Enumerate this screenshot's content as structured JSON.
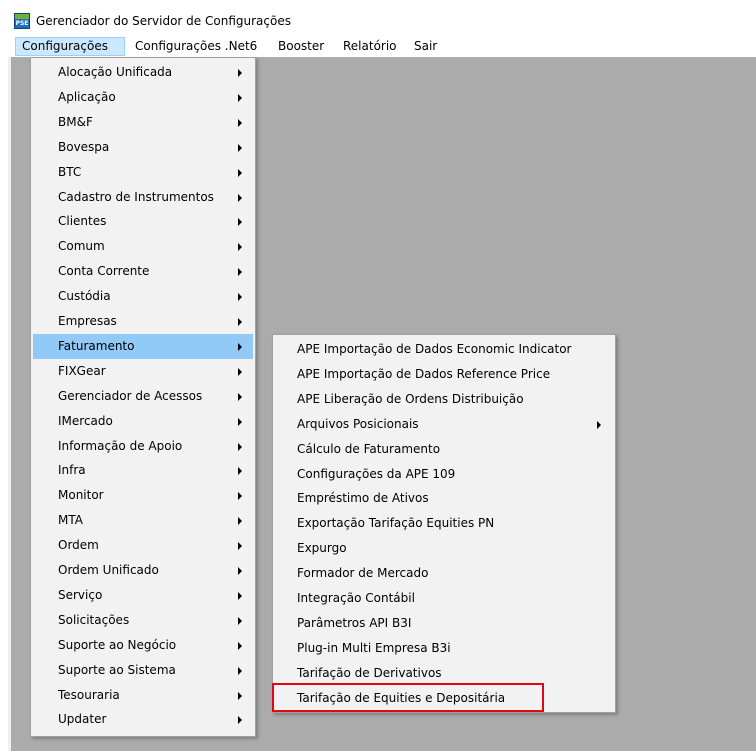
{
  "window": {
    "title": "Gerenciador do Servidor de Configurações",
    "icon_text": "PSE"
  },
  "menubar": {
    "items": [
      "Configurações",
      "Configurações .Net6",
      "Booster",
      "Relatório",
      "Sair"
    ]
  },
  "config_menu": {
    "items": [
      {
        "label": "Alocação Unificada"
      },
      {
        "label": "Aplicação"
      },
      {
        "label": "BM&F"
      },
      {
        "label": "Bovespa"
      },
      {
        "label": "BTC"
      },
      {
        "label": "Cadastro de Instrumentos"
      },
      {
        "label": "Clientes"
      },
      {
        "label": "Comum"
      },
      {
        "label": "Conta Corrente"
      },
      {
        "label": "Custódia"
      },
      {
        "label": "Empresas"
      },
      {
        "label": "Faturamento"
      },
      {
        "label": "FIXGear"
      },
      {
        "label": "Gerenciador de Acessos"
      },
      {
        "label": "IMercado"
      },
      {
        "label": "Informação de Apoio"
      },
      {
        "label": "Infra"
      },
      {
        "label": "Monitor"
      },
      {
        "label": "MTA"
      },
      {
        "label": "Ordem"
      },
      {
        "label": "Ordem Unificado"
      },
      {
        "label": "Serviço"
      },
      {
        "label": "Solicitações"
      },
      {
        "label": "Suporte ao Negócio"
      },
      {
        "label": "Suporte ao Sistema"
      },
      {
        "label": "Tesouraria"
      },
      {
        "label": "Updater"
      }
    ],
    "highlighted": "Faturamento"
  },
  "faturamento_menu": {
    "items": [
      {
        "label": "APE Importação de Dados Economic Indicator",
        "submenu": false
      },
      {
        "label": "APE Importação de Dados Reference Price",
        "submenu": false
      },
      {
        "label": "APE Liberação de Ordens Distribuição",
        "submenu": false
      },
      {
        "label": "Arquivos Posicionais",
        "submenu": true
      },
      {
        "label": "Cálculo de Faturamento",
        "submenu": false
      },
      {
        "label": "Configurações da APE 109",
        "submenu": false
      },
      {
        "label": "Empréstimo de Ativos",
        "submenu": false
      },
      {
        "label": "Exportação Tarifação Equities PN",
        "submenu": false
      },
      {
        "label": "Expurgo",
        "submenu": false
      },
      {
        "label": "Formador de Mercado",
        "submenu": false
      },
      {
        "label": "Integração Contábil",
        "submenu": false
      },
      {
        "label": "Parâmetros API B3I",
        "submenu": false
      },
      {
        "label": "Plug-in Multi Empresa B3i",
        "submenu": false
      },
      {
        "label": "Tarifação de Derivativos",
        "submenu": false
      },
      {
        "label": "Tarifação de Equities e Depositária",
        "submenu": false
      }
    ],
    "annotated": "Tarifação de Equities e Depositária"
  },
  "colors": {
    "client_area": "#ababab",
    "menu_bg": "#f2f2f2",
    "menu_highlight": "#91c9f7",
    "annotation_box": "#e30613"
  }
}
